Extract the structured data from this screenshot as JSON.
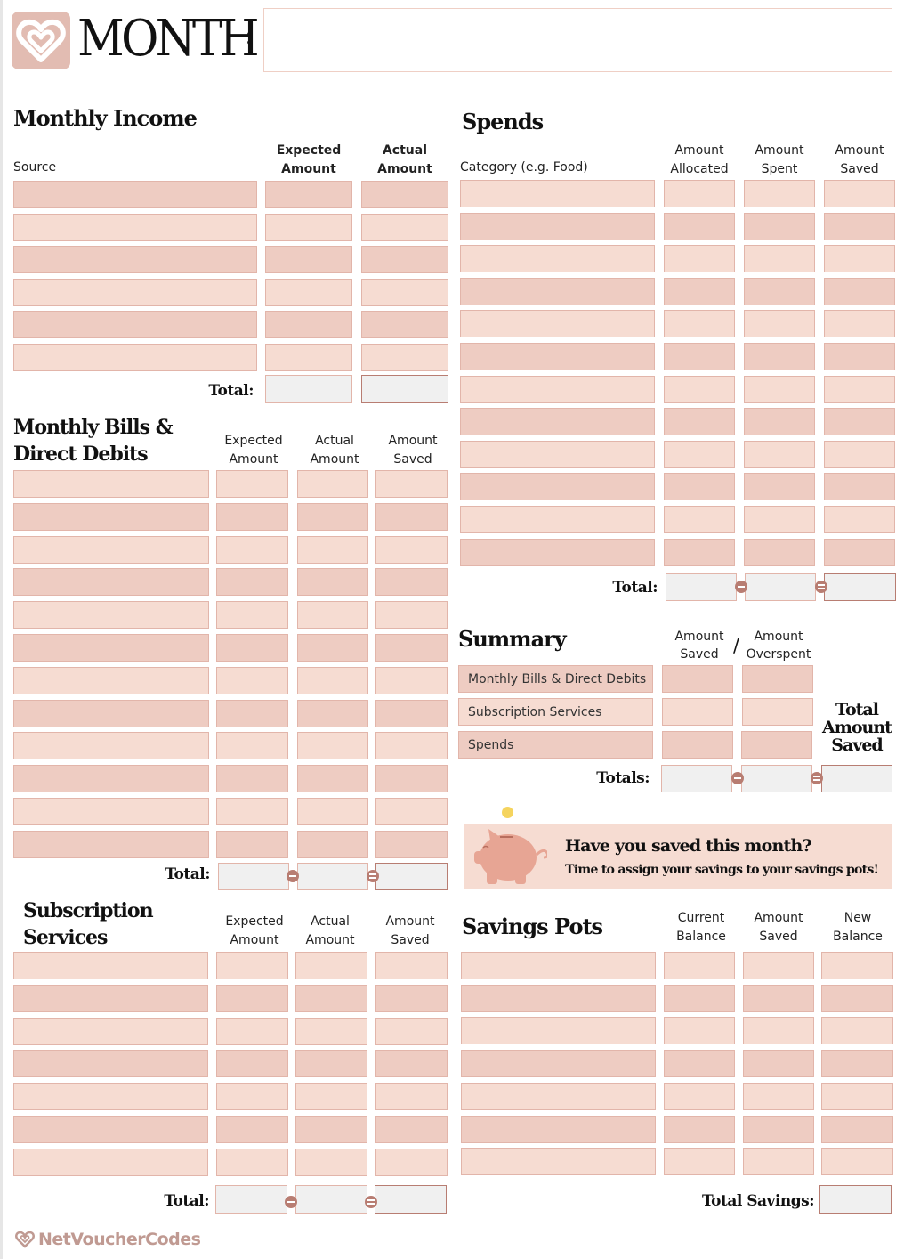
{
  "header": {
    "title": "MONTH",
    "colon": ":",
    "month_input_value": "",
    "logo_icon": "heart-icon"
  },
  "income": {
    "title": "Monthly Income",
    "columns": [
      "Source",
      "Expected Amount",
      "Actual Amount"
    ],
    "col_lines": [
      [
        "Source"
      ],
      [
        "Expected",
        "Amount"
      ],
      [
        "Actual",
        "Amount"
      ]
    ],
    "rows": 6,
    "total_label": "Total:"
  },
  "bills": {
    "title_line1": "Monthly Bills &",
    "title_line2": "Direct Debits",
    "col_lines": [
      [
        "Expected",
        "Amount"
      ],
      [
        "Actual",
        "Amount"
      ],
      [
        "Amount",
        "Saved"
      ]
    ],
    "rows": 12,
    "total_label": "Total:"
  },
  "subscriptions": {
    "title_line1": "Subscription",
    "title_line2": "Services",
    "col_lines": [
      [
        "Expected",
        "Amount"
      ],
      [
        "Actual",
        "Amount"
      ],
      [
        "Amount",
        "Saved"
      ]
    ],
    "rows": 7,
    "total_label": "Total:"
  },
  "spends": {
    "title": "Spends",
    "category_header": "Category (e.g. Food)",
    "col_lines": [
      [
        "Amount",
        "Allocated"
      ],
      [
        "Amount",
        "Spent"
      ],
      [
        "Amount",
        "Saved"
      ]
    ],
    "rows": 12,
    "total_label": "Total:"
  },
  "summary": {
    "title": "Summary",
    "col_lines": [
      [
        "Amount",
        "Saved"
      ],
      [
        "Amount",
        "Overspent"
      ]
    ],
    "separator": "/",
    "rows": [
      "Monthly Bills & Direct Debits",
      "Subscription Services",
      "Spends"
    ],
    "totals_label": "Totals:",
    "total_saved_lines": [
      "Total",
      "Amount",
      "Saved"
    ]
  },
  "banner": {
    "heading": "Have you saved this month?",
    "subtext": "Time to assign your savings to your savings pots!",
    "icon": "piggy-bank-icon",
    "coin_icon": "coin-icon"
  },
  "savings": {
    "title": "Savings Pots",
    "col_lines": [
      [
        "Current",
        "Balance"
      ],
      [
        "Amount",
        "Saved"
      ],
      [
        "New",
        "Balance"
      ]
    ],
    "rows": 7,
    "total_label": "Total Savings:"
  },
  "footer": {
    "brand": "NetVoucherCodes",
    "brand_icon": "heart-icon"
  },
  "colors": {
    "row_light": "#f6dcd2",
    "row_dark": "#eeccc2",
    "border": "#e2b5aa",
    "accent": "#b87d72",
    "logo_bg": "#e2bcb2",
    "brand_text": "#c09a92",
    "coin": "#f5d45e"
  }
}
